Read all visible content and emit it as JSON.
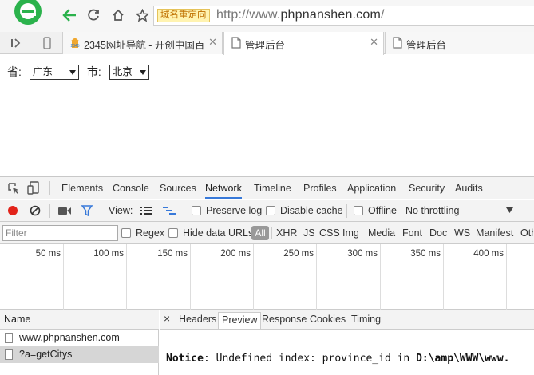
{
  "toolbar": {
    "back_icon": "back-arrow-icon",
    "reload_icon": "reload-icon",
    "home_icon": "home-icon",
    "star_icon": "star-icon",
    "redirect_badge": "域名重定向",
    "url_prefix": "http://www.",
    "url_domain": "phpnanshen.com",
    "url_suffix": "/"
  },
  "tabs": [
    {
      "label": "2345网址导航 - 开创中国百",
      "icon": "2345-favicon",
      "close": "✕"
    },
    {
      "label": "管理后台",
      "icon": "page-icon",
      "close": "✕"
    },
    {
      "label": "管理后台",
      "icon": "page-icon",
      "close": ""
    }
  ],
  "page": {
    "province_label": "省:",
    "province_value": "广东",
    "city_label": "市:",
    "city_value": "北京"
  },
  "devtools": {
    "tabs": [
      "Elements",
      "Console",
      "Sources",
      "Network",
      "Timeline",
      "Profiles",
      "Application",
      "Security",
      "Audits"
    ],
    "active_tab": "Network",
    "controls": {
      "view_label": "View:",
      "preserve_log": "Preserve log",
      "disable_cache": "Disable cache",
      "offline": "Offline",
      "throttling": "No throttling"
    },
    "filter": {
      "placeholder": "Filter",
      "regex": "Regex",
      "hide_data_urls": "Hide data URLs",
      "all": "All",
      "types": [
        "XHR",
        "JS",
        "CSS",
        "Img",
        "Media",
        "Font",
        "Doc",
        "WS",
        "Manifest",
        "Oth"
      ]
    },
    "timeline_ticks": [
      "50 ms",
      "100 ms",
      "150 ms",
      "200 ms",
      "250 ms",
      "300 ms",
      "350 ms",
      "400 ms"
    ],
    "requests": {
      "header": "Name",
      "rows": [
        "www.phpnanshen.com",
        "?a=getCitys"
      ]
    },
    "detail": {
      "close": "×",
      "tabs": [
        "Headers",
        "Preview",
        "Response",
        "Cookies",
        "Timing"
      ],
      "active_tab": "Preview",
      "preview_notice": "Notice",
      "preview_text": ": Undefined index: province_id in ",
      "preview_path": "D:\\amp\\WWW\\www."
    }
  },
  "colors": {
    "accent_green": "#2bb24c",
    "devtools_active": "#3879d9",
    "record_red": "#e2231a",
    "filter_blue": "#3879d9"
  }
}
